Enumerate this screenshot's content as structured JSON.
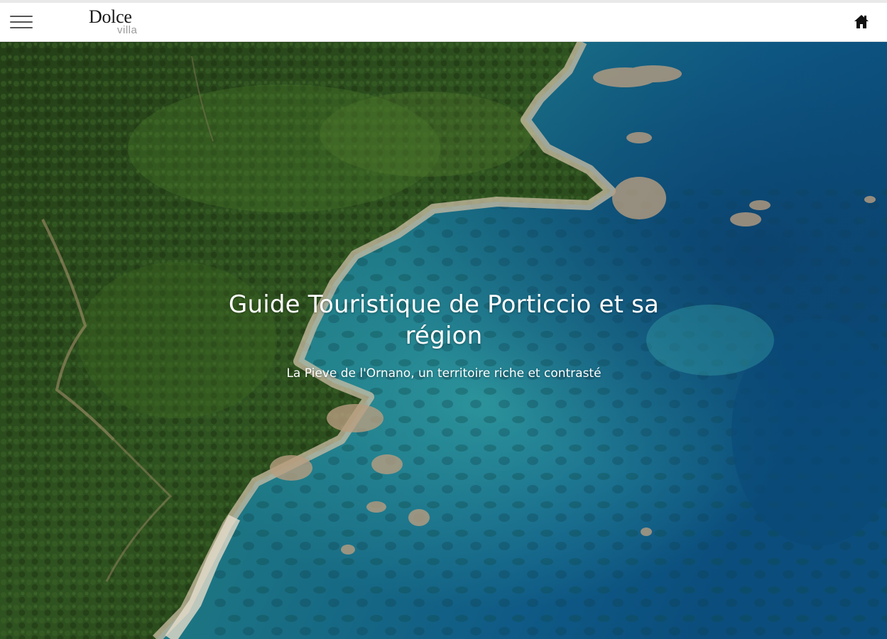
{
  "header": {
    "menu_icon": "hamburger-menu-icon",
    "logo": {
      "main": "Dolce",
      "sub": "villa"
    },
    "home_icon": "home-icon"
  },
  "hero": {
    "image": "aerial-coastline-photo",
    "title": "Guide Touristique de Porticcio et sa région",
    "subtitle": "La Pieve de l'Ornano, un territoire riche et contrasté"
  },
  "colors": {
    "header_bg": "#ffffff",
    "forest": "#2c4a1c",
    "sea_shallow": "#2a8f93",
    "sea_deep": "#0d4f7a",
    "text_on_image": "#ffffff"
  }
}
